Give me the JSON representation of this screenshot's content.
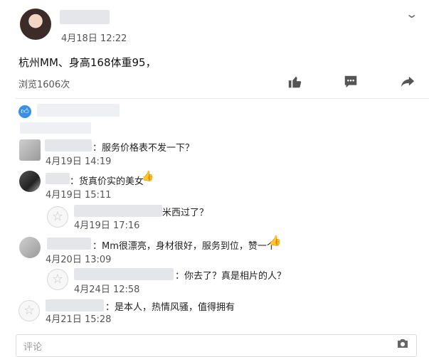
{
  "post": {
    "time": "4月18日 12:22",
    "text": "杭州MM、身高168体重95，",
    "views": "浏览1606次"
  },
  "icons": {
    "collapse": "chevron-down-icon",
    "like": "thumbs-up-icon",
    "comment": "comment-bubble-icon",
    "share": "share-arrow-icon",
    "likes": "like-badge-icon",
    "camera": "camera-icon"
  },
  "comments": [
    {
      "text": "：服务价格表不发一下？",
      "time": "4月19日 14:19"
    },
    {
      "text": "：货真价实的美女",
      "time": "4月19日 15:11"
    },
    {
      "text": "米西过了？",
      "time": "4月19日 17:16"
    },
    {
      "text": "：Mm很漂亮，身材很好，服务到位，赞一个",
      "time": "4月20日 13:09"
    },
    {
      "text": "：你去了？真是相片的人？",
      "time": "4月24日 12:58"
    },
    {
      "text": "：是本人，热情风骚，值得拥有",
      "time": "4月21日 15:28"
    }
  ],
  "comment_input": {
    "placeholder": "评论"
  },
  "colors": {
    "accent": "#3b8ee6",
    "thumb": "#e8b35a"
  }
}
